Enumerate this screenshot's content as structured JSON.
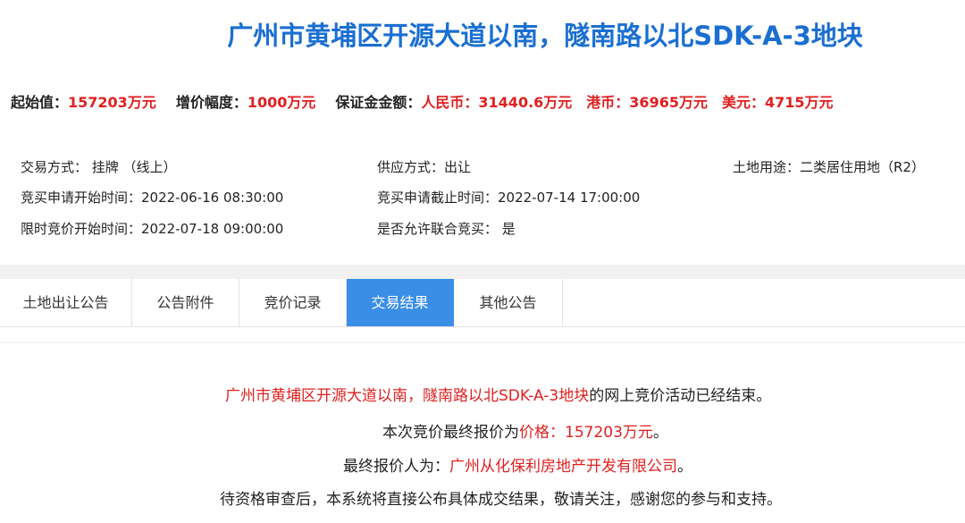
{
  "page": {
    "title": "广州市黄埔区开源大道以南，隧南路以北SDK-A-3地块"
  },
  "price_row": {
    "start_label": "起始值：",
    "start_value": "157203万元",
    "increment_label": "增价幅度：",
    "increment_value": "1000万元",
    "deposit_label": "保证金金额：",
    "rmb_value": "人民币：31440.6万元",
    "hkd_value": "港币：36965万元",
    "usd_value": "美元：4715万元"
  },
  "info": {
    "trade_mode": "交易方式：  挂牌  （线上）",
    "supply_mode": "供应方式：出让",
    "land_use": "土地用途：二类居住用地（R2）",
    "apply_start": "竞买申请开始时间：2022-06-16 08:30:00",
    "apply_end": "竞买申请截止时间：2022-07-14 17:00:00",
    "auction_start": "限时竞价开始时间：2022-07-18 09:00:00",
    "joint_bid": "是否允许联合竞买：  是"
  },
  "tabs": [
    {
      "label": "土地出让公告"
    },
    {
      "label": "公告附件"
    },
    {
      "label": "竞价记录"
    },
    {
      "label": "交易结果"
    },
    {
      "label": "其他公告"
    }
  ],
  "result": {
    "line1_red": "广州市黄埔区开源大道以南，隧南路以北SDK-A-3地块",
    "line1_rest": "的网上竞价活动已经结束。",
    "line2_pre": "本次竞价最终报价为",
    "line2_red": "价格：157203万元",
    "line2_post": "。",
    "line3_pre": "最终报价人为：",
    "line3_red": "广州从化保利房地产开发有限公司",
    "line3_post": "。",
    "line4": "待资格审查后，本系统将直接公布具体成交结果，敬请关注，感谢您的参与和支持。"
  },
  "colors": {
    "title_blue": "#1a6fd1",
    "price_red": "#e02020",
    "active_tab": "#3a8ee6"
  }
}
